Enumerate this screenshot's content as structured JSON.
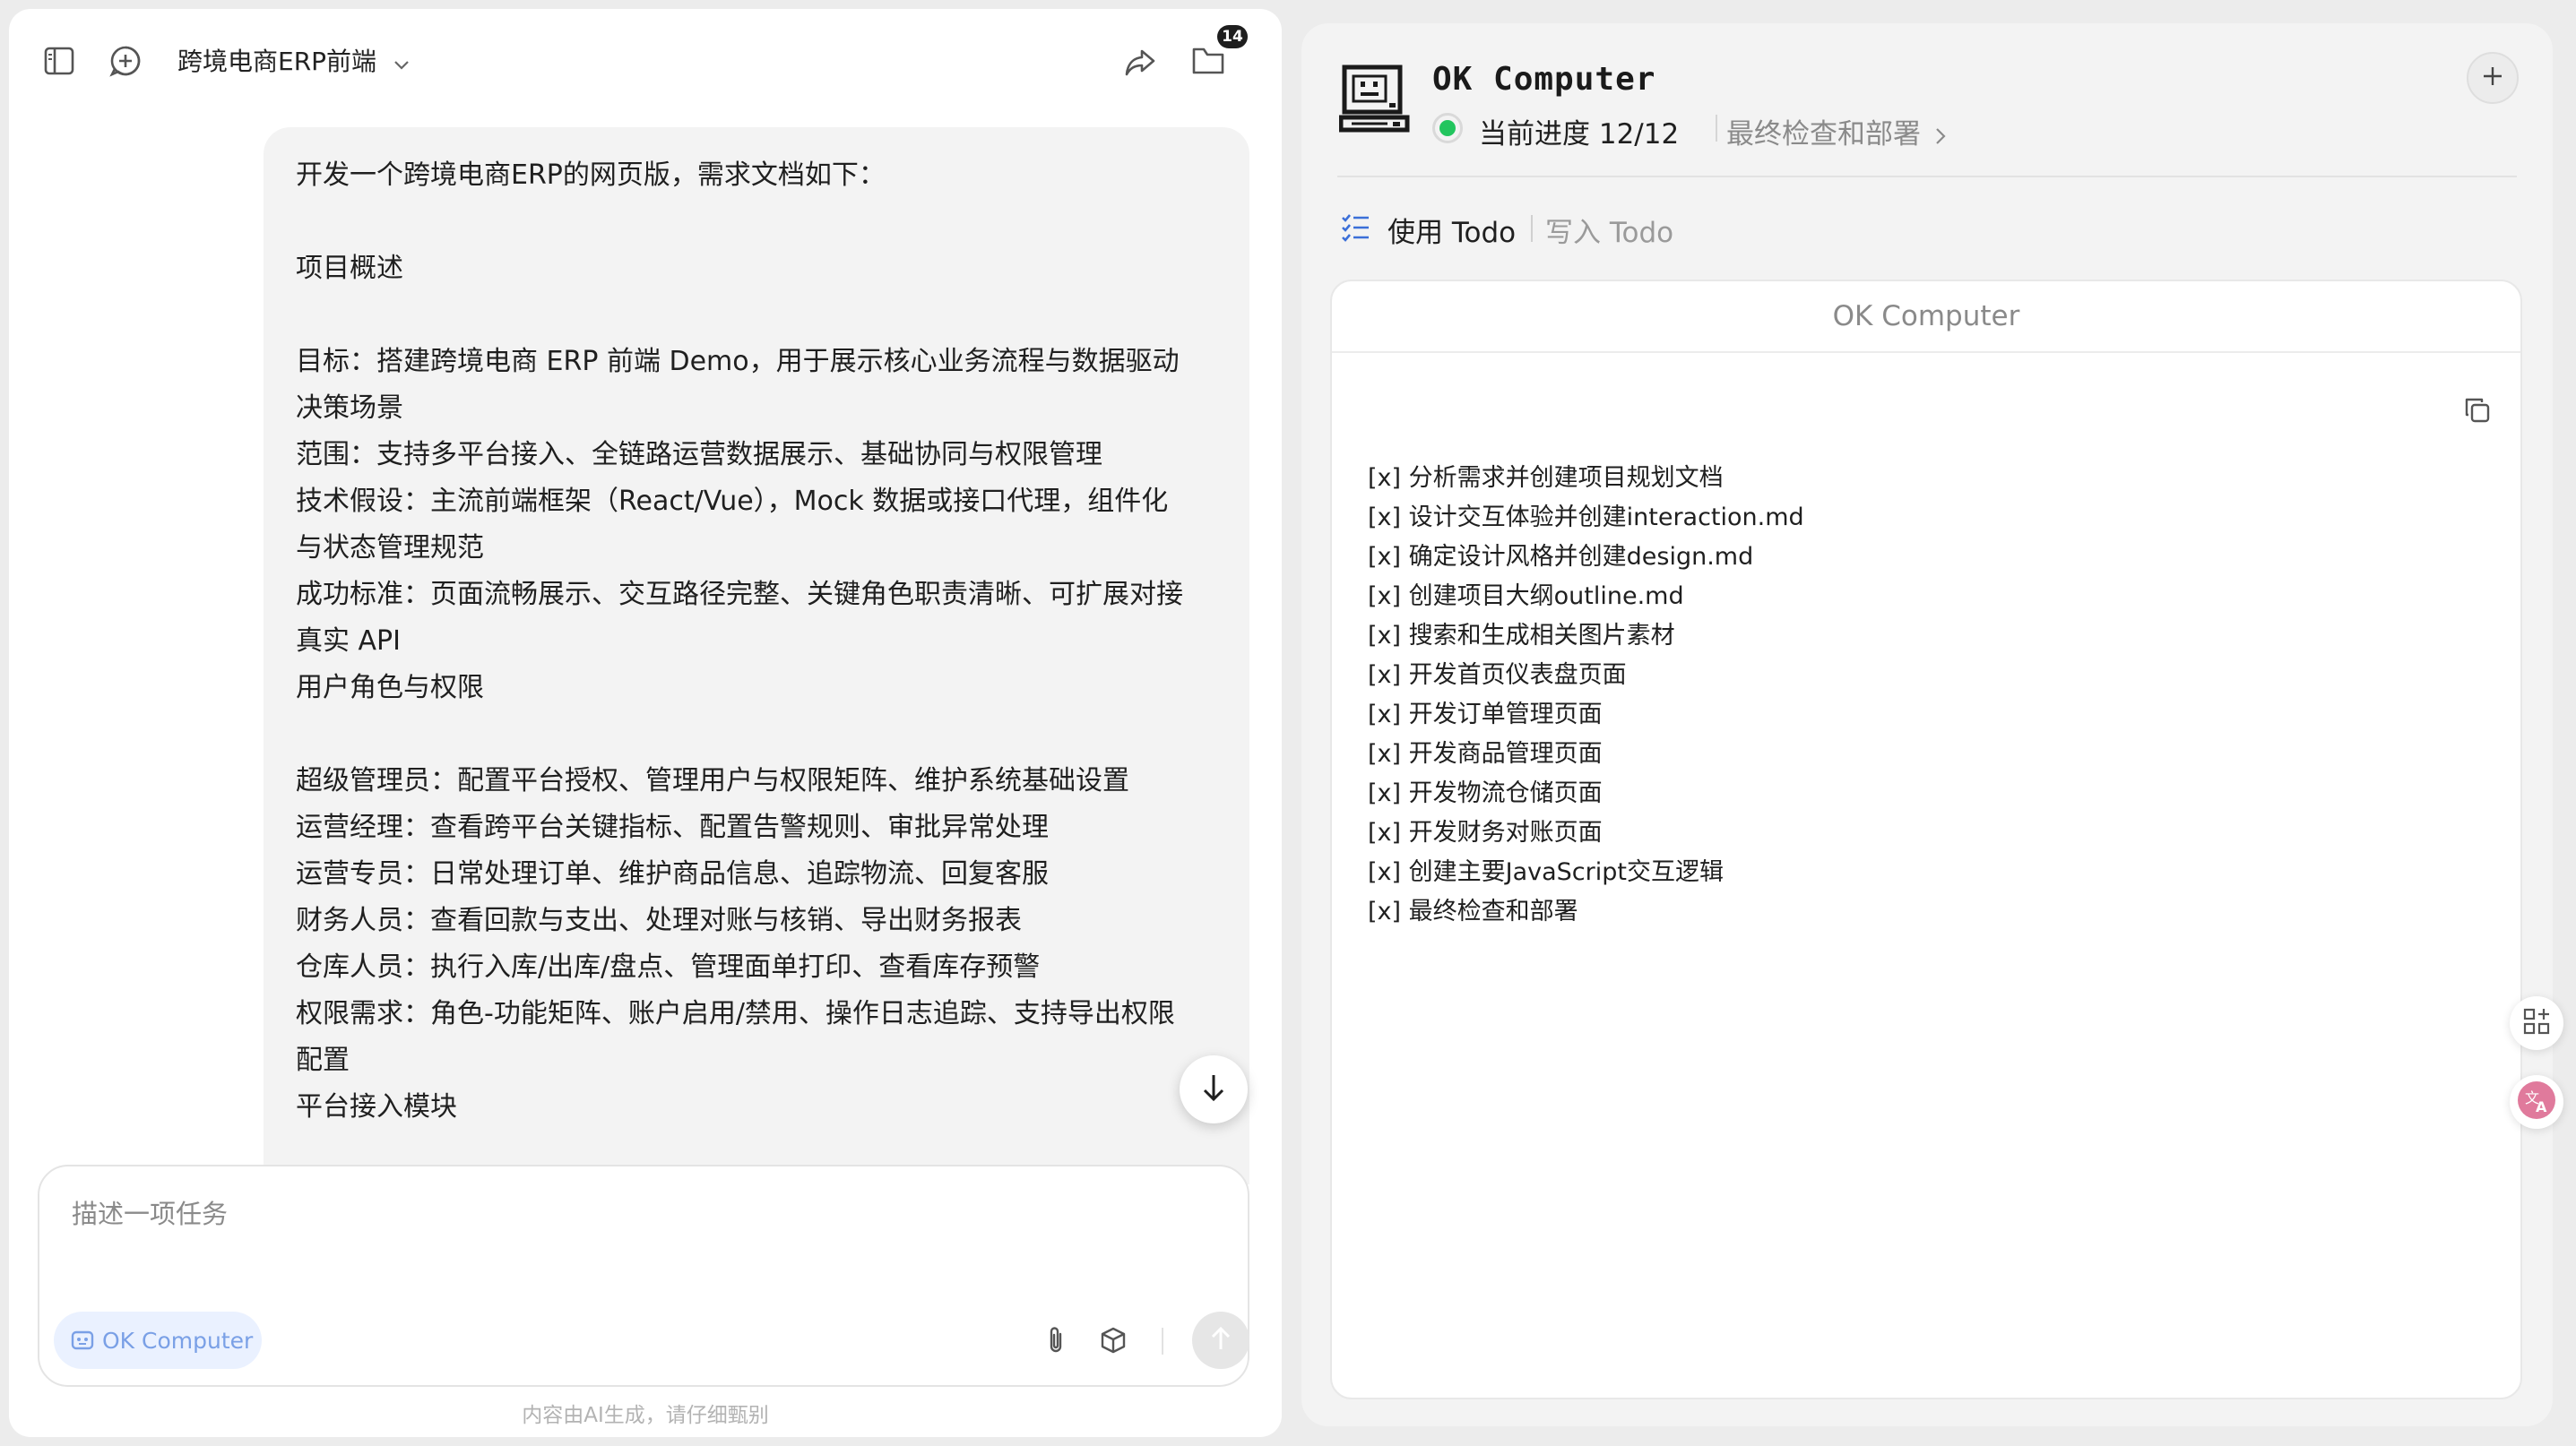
{
  "header": {
    "project_title": "跨境电商ERP前端",
    "files_badge": "14"
  },
  "message": {
    "lines": [
      "开发一个跨境电商ERP的网页版，需求文档如下：",
      "",
      "项目概述",
      "",
      "目标：搭建跨境电商 ERP 前端 Demo，用于展示核心业务流程与数据驱动",
      "决策场景",
      "范围：支持多平台接入、全链路运营数据展示、基础协同与权限管理",
      "技术假设：主流前端框架（React/Vue），Mock 数据或接口代理，组件化",
      "与状态管理规范",
      "成功标准：页面流畅展示、交互路径完整、关键角色职责清晰、可扩展对接",
      "真实 API",
      "用户角色与权限",
      "",
      "超级管理员：配置平台授权、管理用户与权限矩阵、维护系统基础设置",
      "运营经理：查看跨平台关键指标、配置告警规则、审批异常处理",
      "运营专员：日常处理订单、维护商品信息、追踪物流、回复客服",
      "财务人员：查看回款与支出、处理对账与核销、导出财务报表",
      "仓库人员：执行入库/出库/盘点、管理面单打印、查看库存预警",
      "权限需求：角色-功能矩阵、账户启用/禁用、操作日志追踪、支持导出权限",
      "配置",
      "平台接入模块"
    ]
  },
  "composer": {
    "placeholder": "描述一项任务",
    "mode_chip": "OK Computer",
    "footnote": "内容由AI生成，请仔细甄别"
  },
  "panel": {
    "title": "OK Computer",
    "progress": "当前进度 12/12",
    "current_step": "最终检查和部署",
    "tab_use": "使用 Todo",
    "tab_write": "写入 Todo",
    "card_title": "OK Computer",
    "todos": [
      "[x] 分析需求并创建项目规划文档",
      "[x] 设计交互体验并创建interaction.md",
      "[x] 确定设计风格并创建design.md",
      "[x] 创建项目大纲outline.md",
      "[x] 搜索和生成相关图片素材",
      "[x] 开发首页仪表盘页面",
      "[x] 开发订单管理页面",
      "[x] 开发商品管理页面",
      "[x] 开发物流仓储页面",
      "[x] 开发财务对账页面",
      "[x] 创建主要JavaScript交互逻辑",
      "[x] 最终检查和部署"
    ]
  },
  "colors": {
    "status_green": "#22c55e",
    "chip_blue": "#7aa0e6",
    "todo_icon_blue": "#3b6fd8"
  }
}
